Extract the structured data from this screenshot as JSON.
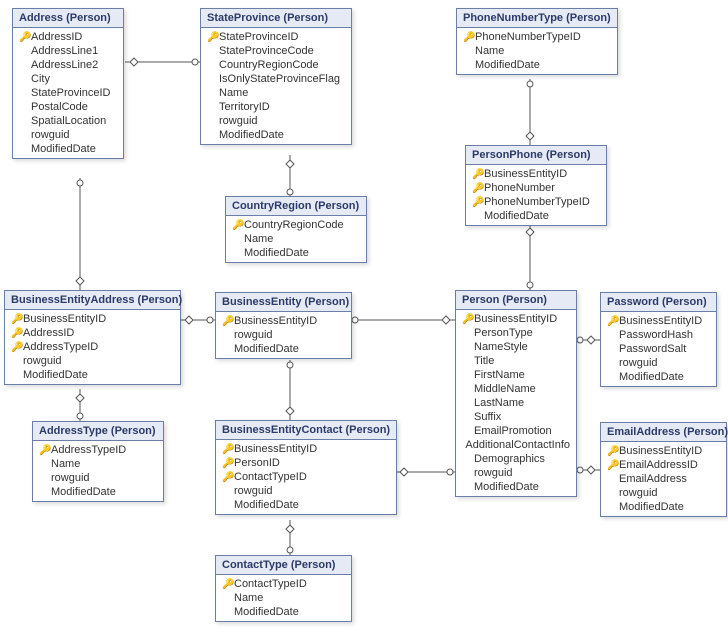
{
  "entities": {
    "address": {
      "title": "Address (Person)",
      "columns": [
        {
          "pk": true,
          "name": "AddressID"
        },
        {
          "pk": false,
          "name": "AddressLine1"
        },
        {
          "pk": false,
          "name": "AddressLine2"
        },
        {
          "pk": false,
          "name": "City"
        },
        {
          "pk": false,
          "name": "StateProvinceID"
        },
        {
          "pk": false,
          "name": "PostalCode"
        },
        {
          "pk": false,
          "name": "SpatialLocation"
        },
        {
          "pk": false,
          "name": "rowguid"
        },
        {
          "pk": false,
          "name": "ModifiedDate"
        }
      ]
    },
    "stateprovince": {
      "title": "StateProvince (Person)",
      "columns": [
        {
          "pk": true,
          "name": "StateProvinceID"
        },
        {
          "pk": false,
          "name": "StateProvinceCode"
        },
        {
          "pk": false,
          "name": "CountryRegionCode"
        },
        {
          "pk": false,
          "name": "IsOnlyStateProvinceFlag"
        },
        {
          "pk": false,
          "name": "Name"
        },
        {
          "pk": false,
          "name": "TerritoryID"
        },
        {
          "pk": false,
          "name": "rowguid"
        },
        {
          "pk": false,
          "name": "ModifiedDate"
        }
      ]
    },
    "phonenumbertype": {
      "title": "PhoneNumberType (Person)",
      "columns": [
        {
          "pk": true,
          "name": "PhoneNumberTypeID"
        },
        {
          "pk": false,
          "name": "Name"
        },
        {
          "pk": false,
          "name": "ModifiedDate"
        }
      ]
    },
    "countryregion": {
      "title": "CountryRegion (Person)",
      "columns": [
        {
          "pk": true,
          "name": "CountryRegionCode"
        },
        {
          "pk": false,
          "name": "Name"
        },
        {
          "pk": false,
          "name": "ModifiedDate"
        }
      ]
    },
    "personphone": {
      "title": "PersonPhone (Person)",
      "columns": [
        {
          "pk": true,
          "name": "BusinessEntityID"
        },
        {
          "pk": true,
          "name": "PhoneNumber"
        },
        {
          "pk": true,
          "name": "PhoneNumberTypeID"
        },
        {
          "pk": false,
          "name": "ModifiedDate"
        }
      ]
    },
    "businessentityaddress": {
      "title": "BusinessEntityAddress (Person)",
      "columns": [
        {
          "pk": true,
          "name": "BusinessEntityID"
        },
        {
          "pk": true,
          "name": "AddressID"
        },
        {
          "pk": true,
          "name": "AddressTypeID"
        },
        {
          "pk": false,
          "name": "rowguid"
        },
        {
          "pk": false,
          "name": "ModifiedDate"
        }
      ]
    },
    "businessentity": {
      "title": "BusinessEntity (Person)",
      "columns": [
        {
          "pk": true,
          "name": "BusinessEntityID"
        },
        {
          "pk": false,
          "name": "rowguid"
        },
        {
          "pk": false,
          "name": "ModifiedDate"
        }
      ]
    },
    "person": {
      "title": "Person (Person)",
      "columns": [
        {
          "pk": true,
          "name": "BusinessEntityID"
        },
        {
          "pk": false,
          "name": "PersonType"
        },
        {
          "pk": false,
          "name": "NameStyle"
        },
        {
          "pk": false,
          "name": "Title"
        },
        {
          "pk": false,
          "name": "FirstName"
        },
        {
          "pk": false,
          "name": "MiddleName"
        },
        {
          "pk": false,
          "name": "LastName"
        },
        {
          "pk": false,
          "name": "Suffix"
        },
        {
          "pk": false,
          "name": "EmailPromotion"
        },
        {
          "pk": false,
          "name": "AdditionalContactInfo"
        },
        {
          "pk": false,
          "name": "Demographics"
        },
        {
          "pk": false,
          "name": "rowguid"
        },
        {
          "pk": false,
          "name": "ModifiedDate"
        }
      ]
    },
    "password": {
      "title": "Password (Person)",
      "columns": [
        {
          "pk": true,
          "name": "BusinessEntityID"
        },
        {
          "pk": false,
          "name": "PasswordHash"
        },
        {
          "pk": false,
          "name": "PasswordSalt"
        },
        {
          "pk": false,
          "name": "rowguid"
        },
        {
          "pk": false,
          "name": "ModifiedDate"
        }
      ]
    },
    "addresstype": {
      "title": "AddressType (Person)",
      "columns": [
        {
          "pk": true,
          "name": "AddressTypeID"
        },
        {
          "pk": false,
          "name": "Name"
        },
        {
          "pk": false,
          "name": "rowguid"
        },
        {
          "pk": false,
          "name": "ModifiedDate"
        }
      ]
    },
    "businessentitycontact": {
      "title": "BusinessEntityContact (Person)",
      "columns": [
        {
          "pk": true,
          "name": "BusinessEntityID"
        },
        {
          "pk": true,
          "name": "PersonID"
        },
        {
          "pk": true,
          "name": "ContactTypeID"
        },
        {
          "pk": false,
          "name": "rowguid"
        },
        {
          "pk": false,
          "name": "ModifiedDate"
        }
      ]
    },
    "emailaddress": {
      "title": "EmailAddress (Person)",
      "columns": [
        {
          "pk": true,
          "name": "BusinessEntityID"
        },
        {
          "pk": true,
          "name": "EmailAddressID"
        },
        {
          "pk": false,
          "name": "EmailAddress"
        },
        {
          "pk": false,
          "name": "rowguid"
        },
        {
          "pk": false,
          "name": "ModifiedDate"
        }
      ]
    },
    "contacttype": {
      "title": "ContactType (Person)",
      "columns": [
        {
          "pk": true,
          "name": "ContactTypeID"
        },
        {
          "pk": false,
          "name": "Name"
        },
        {
          "pk": false,
          "name": "ModifiedDate"
        }
      ]
    }
  },
  "relationships": [
    {
      "from": "address",
      "to": "stateprovince"
    },
    {
      "from": "stateprovince",
      "to": "countryregion"
    },
    {
      "from": "personphone",
      "to": "phonenumbertype"
    },
    {
      "from": "personphone",
      "to": "person"
    },
    {
      "from": "businessentityaddress",
      "to": "address"
    },
    {
      "from": "businessentityaddress",
      "to": "addresstype"
    },
    {
      "from": "businessentityaddress",
      "to": "businessentity"
    },
    {
      "from": "person",
      "to": "businessentity"
    },
    {
      "from": "password",
      "to": "person"
    },
    {
      "from": "businessentitycontact",
      "to": "businessentity"
    },
    {
      "from": "businessentitycontact",
      "to": "person"
    },
    {
      "from": "businessentitycontact",
      "to": "contacttype"
    },
    {
      "from": "emailaddress",
      "to": "person"
    }
  ]
}
